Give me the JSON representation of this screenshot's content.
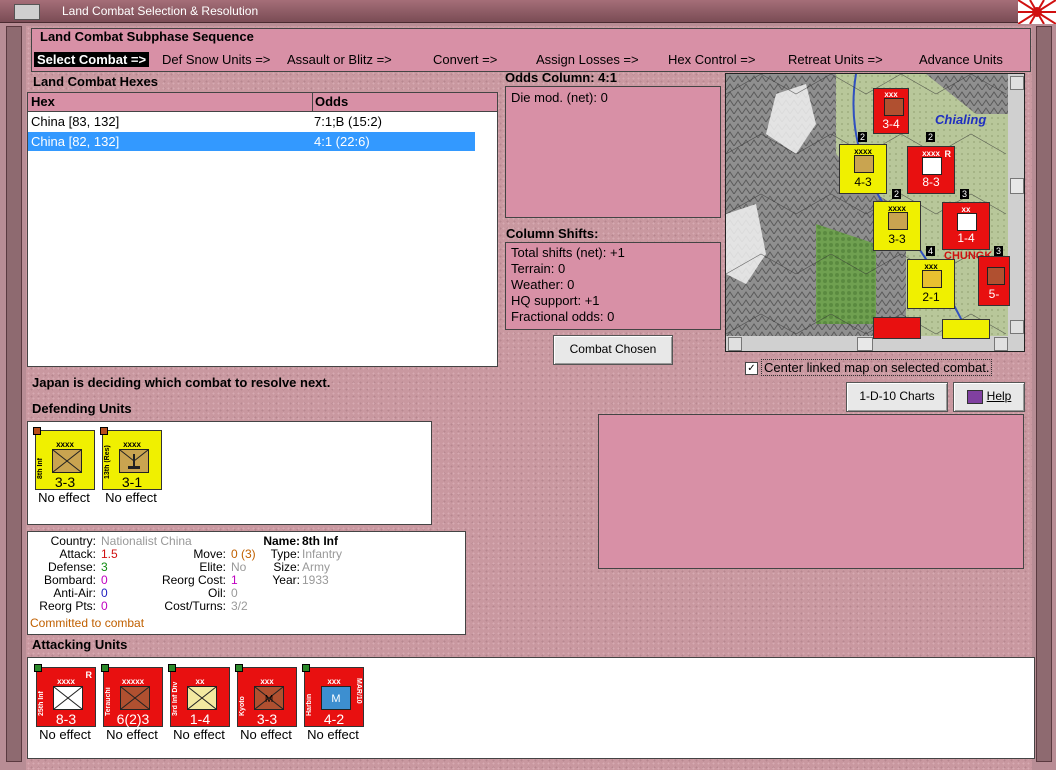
{
  "window": {
    "title": "Land Combat Selection & Resolution"
  },
  "subphase": {
    "label": "Land Combat Subphase Sequence",
    "steps": [
      {
        "label": "Select Combat =>",
        "selected": true
      },
      {
        "label": "Def Snow Units =>"
      },
      {
        "label": "Assault or Blitz =>"
      },
      {
        "label": "Convert =>"
      },
      {
        "label": "Assign Losses =>"
      },
      {
        "label": "Hex Control =>"
      },
      {
        "label": "Retreat Units =>"
      },
      {
        "label": "Advance Units"
      }
    ]
  },
  "hexes": {
    "label": "Land Combat Hexes",
    "columns": [
      "Hex",
      "Odds"
    ],
    "rows": [
      {
        "hex": "China [83, 132]",
        "odds": "7:1;B (15:2)"
      },
      {
        "hex": "China [82, 132]",
        "odds": "4:1 (22:6)",
        "selected": true
      }
    ]
  },
  "odds": {
    "label": "Odds Column: 4:1",
    "die_mod": "Die mod. (net): 0"
  },
  "shifts": {
    "label": "Column Shifts:",
    "lines": [
      "Total shifts (net): +1",
      "Terrain: 0",
      "Weather: 0",
      "HQ support: +1",
      "Fractional odds: 0"
    ]
  },
  "buttons": {
    "combat_chosen": "Combat Chosen",
    "charts": "1-D-10 Charts",
    "help": "Help"
  },
  "center_map": {
    "label": "Center linked map on selected combat.",
    "checked": true
  },
  "status": "Japan is deciding which combat to resolve next.",
  "map": {
    "place_name": "Chialing",
    "place_name2": "CHUNGK",
    "counters": [
      {
        "val": "3-4",
        "size": "xxx",
        "color": "red"
      },
      {
        "val": "4-3",
        "size": "xxxx",
        "color": "yellow"
      },
      {
        "val": "8-3",
        "size": "xxxx",
        "color": "red",
        "tag": "R"
      },
      {
        "val": "3-3",
        "size": "xxxx",
        "color": "yellow"
      },
      {
        "val": "1-4",
        "size": "xx",
        "color": "red"
      },
      {
        "val": "2-1",
        "size": "xxx",
        "color": "yellow"
      },
      {
        "val": "5-",
        "size": "",
        "color": "red"
      }
    ],
    "stack_numbers": [
      "2",
      "2",
      "2",
      "3",
      "3",
      "4"
    ]
  },
  "defending": {
    "label": "Defending Units",
    "units": [
      {
        "name": "8th Inf",
        "size": "xxxx",
        "val": "3-3",
        "effect": "No effect",
        "sym": "tan"
      },
      {
        "name": "13th (Res)",
        "size": "xxxx",
        "val": "3-1",
        "effect": "No effect",
        "sym": "tan"
      }
    ]
  },
  "details": {
    "country": {
      "label": "Country:",
      "value": "Nationalist China"
    },
    "attack": {
      "label": "Attack:",
      "value": "1.5"
    },
    "defense": {
      "label": "Defense:",
      "value": "3"
    },
    "bombard": {
      "label": "Bombard:",
      "value": "0"
    },
    "anti_air": {
      "label": "Anti-Air:",
      "value": "0"
    },
    "reorg_pts": {
      "label": "Reorg Pts:",
      "value": "0"
    },
    "move": {
      "label": "Move:",
      "value": "0 (3)"
    },
    "elite": {
      "label": "Elite:",
      "value": "No"
    },
    "reorg_cost": {
      "label": "Reorg Cost:",
      "value": "1"
    },
    "oil": {
      "label": "Oil:",
      "value": "0"
    },
    "cost_turns": {
      "label": "Cost/Turns:",
      "value": "3/2"
    },
    "name": {
      "label": "Name:",
      "value": "8th Inf"
    },
    "type": {
      "label": "Type:",
      "value": "Infantry"
    },
    "size": {
      "label": "Size:",
      "value": "Army"
    },
    "year": {
      "label": "Year:",
      "value": "1933"
    },
    "committed": "Committed to combat"
  },
  "attacking": {
    "label": "Attacking Units",
    "units": [
      {
        "name": "25th Inf",
        "size": "xxxx",
        "val": "8-3",
        "effect": "No effect",
        "tag": "R",
        "sym": "wht"
      },
      {
        "name": "Terauchi",
        "size": "xxxxx",
        "val": "6(2)3",
        "effect": "No effect",
        "sym": "brn"
      },
      {
        "name": "3rd Inf Div",
        "size": "xx",
        "val": "1-4",
        "effect": "No effect",
        "sym": "yl"
      },
      {
        "name": "Kyoto",
        "size": "xxx",
        "val": "3-3",
        "effect": "No effect",
        "sym": "brn",
        "mark": "M"
      },
      {
        "name": "Harbin",
        "size": "xxx",
        "val": "4-2",
        "effect": "No effect",
        "sym": "blu",
        "mark": "M",
        "side": "MAR/10"
      }
    ]
  },
  "colors": {
    "panel_pink": "#d890a6",
    "selection": "#3399ff",
    "unit_red": "#e81010",
    "unit_yellow": "#f0f000"
  }
}
